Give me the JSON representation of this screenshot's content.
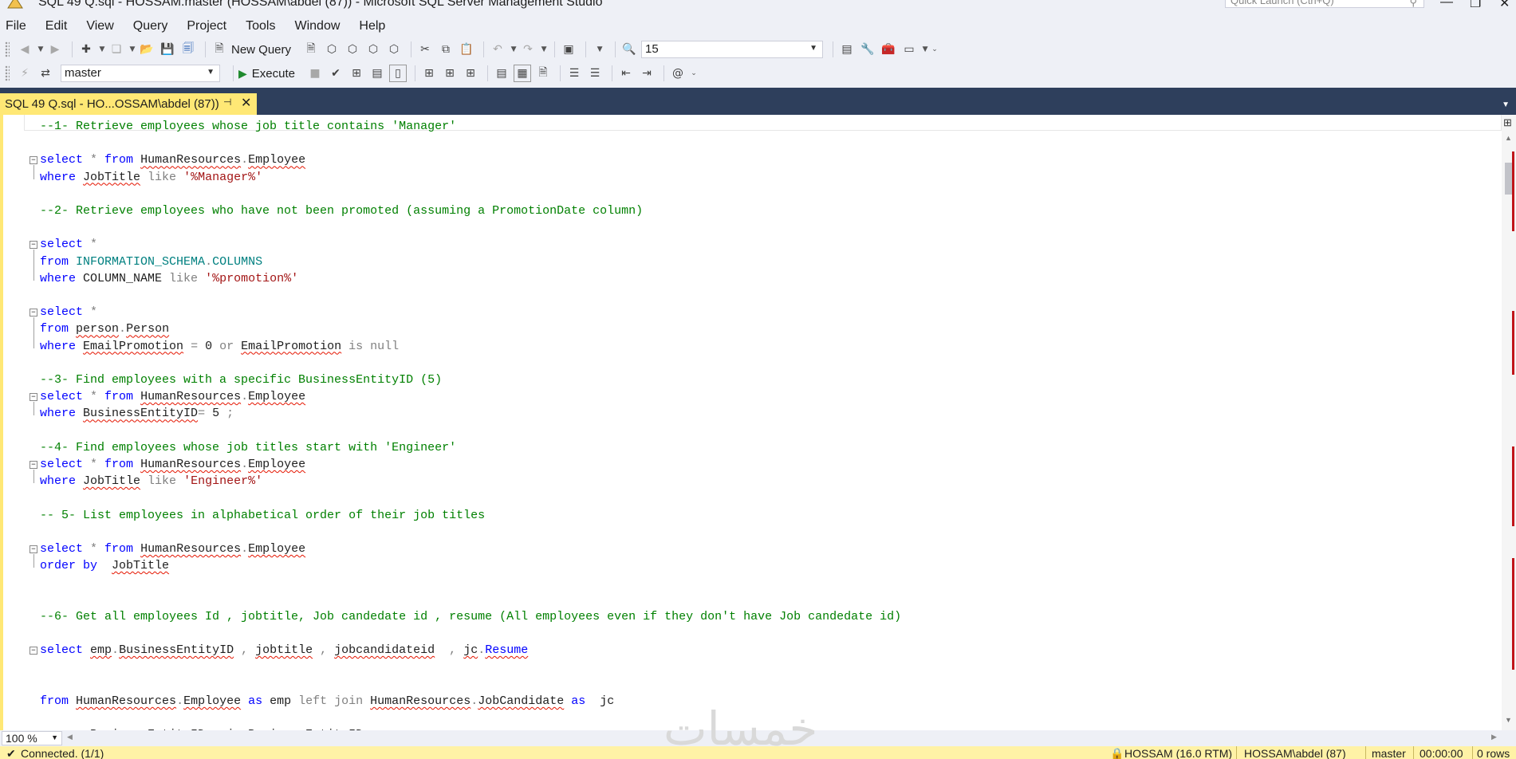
{
  "window": {
    "title": "SQL 49 Q.sql - HOSSAM.master (HOSSAM\\abdel (87)) - Microsoft SQL Server Management Studio",
    "quick_launch_placeholder": "Quick Launch (Ctrl+Q)"
  },
  "menu": [
    "File",
    "Edit",
    "View",
    "Query",
    "Project",
    "Tools",
    "Window",
    "Help"
  ],
  "toolbar": {
    "new_query_label": "New Query",
    "font_size_value": "15",
    "database_value": "master",
    "execute_label": "Execute"
  },
  "tab": {
    "label": "SQL 49 Q.sql - HO...OSSAM\\abdel (87))"
  },
  "code_lines": [
    [
      {
        "t": "--1- Retrieve employees whose job title contains 'Manager'",
        "c": "cm"
      }
    ],
    [],
    [
      {
        "t": "select",
        "c": "kw"
      },
      {
        "t": " * ",
        "c": "gr"
      },
      {
        "t": "from",
        "c": "kw"
      },
      {
        "t": " "
      },
      {
        "t": "HumanResources",
        "c": "sq"
      },
      {
        "t": ".",
        "c": "gr"
      },
      {
        "t": "Employee",
        "c": "sq"
      }
    ],
    [
      {
        "t": "where",
        "c": "kw"
      },
      {
        "t": " "
      },
      {
        "t": "JobTitle",
        "c": "sq"
      },
      {
        "t": " like ",
        "c": "gr"
      },
      {
        "t": "'%Manager%'",
        "c": "st"
      }
    ],
    [],
    [
      {
        "t": "--2- Retrieve employees who have not been promoted (assuming a PromotionDate column)",
        "c": "cm"
      }
    ],
    [],
    [
      {
        "t": "select",
        "c": "kw"
      },
      {
        "t": " *",
        "c": "gr"
      }
    ],
    [
      {
        "t": "from",
        "c": "kw"
      },
      {
        "t": " "
      },
      {
        "t": "INFORMATION_SCHEMA",
        "c": "sy"
      },
      {
        "t": ".",
        "c": "gr"
      },
      {
        "t": "COLUMNS",
        "c": "sy"
      }
    ],
    [
      {
        "t": "where",
        "c": "kw"
      },
      {
        "t": " COLUMN_NAME "
      },
      {
        "t": "like",
        "c": "gr"
      },
      {
        "t": " "
      },
      {
        "t": "'%promotion%'",
        "c": "st"
      }
    ],
    [],
    [
      {
        "t": "select",
        "c": "kw"
      },
      {
        "t": " *",
        "c": "gr"
      }
    ],
    [
      {
        "t": "from",
        "c": "kw"
      },
      {
        "t": " "
      },
      {
        "t": "person",
        "c": "sq"
      },
      {
        "t": ".",
        "c": "gr"
      },
      {
        "t": "Person",
        "c": "sq"
      }
    ],
    [
      {
        "t": "where",
        "c": "kw"
      },
      {
        "t": " "
      },
      {
        "t": "EmailPromotion",
        "c": "sq"
      },
      {
        "t": " = ",
        "c": "gr"
      },
      {
        "t": "0 "
      },
      {
        "t": "or",
        "c": "gr"
      },
      {
        "t": " "
      },
      {
        "t": "EmailPromotion",
        "c": "sq"
      },
      {
        "t": " is null",
        "c": "gr"
      }
    ],
    [],
    [
      {
        "t": "--3- Find employees with a specific BusinessEntityID (5)",
        "c": "cm"
      }
    ],
    [
      {
        "t": "select",
        "c": "kw"
      },
      {
        "t": " * ",
        "c": "gr"
      },
      {
        "t": "from",
        "c": "kw"
      },
      {
        "t": " "
      },
      {
        "t": "HumanResources",
        "c": "sq"
      },
      {
        "t": ".",
        "c": "gr"
      },
      {
        "t": "Employee",
        "c": "sq"
      }
    ],
    [
      {
        "t": "where",
        "c": "kw"
      },
      {
        "t": " "
      },
      {
        "t": "BusinessEntityID",
        "c": "sq"
      },
      {
        "t": "= ",
        "c": "gr"
      },
      {
        "t": "5 "
      },
      {
        "t": ";",
        "c": "gr"
      }
    ],
    [],
    [
      {
        "t": "--4- Find employees whose job titles start with 'Engineer'",
        "c": "cm"
      }
    ],
    [
      {
        "t": "select",
        "c": "kw"
      },
      {
        "t": " * ",
        "c": "gr"
      },
      {
        "t": "from",
        "c": "kw"
      },
      {
        "t": " "
      },
      {
        "t": "HumanResources",
        "c": "sq"
      },
      {
        "t": ".",
        "c": "gr"
      },
      {
        "t": "Employee",
        "c": "sq"
      }
    ],
    [
      {
        "t": "where",
        "c": "kw"
      },
      {
        "t": " "
      },
      {
        "t": "JobTitle",
        "c": "sq"
      },
      {
        "t": " like ",
        "c": "gr"
      },
      {
        "t": "'Engineer%'",
        "c": "st"
      }
    ],
    [],
    [
      {
        "t": "-- 5- List employees in alphabetical order of their job titles",
        "c": "cm"
      }
    ],
    [],
    [
      {
        "t": "select",
        "c": "kw"
      },
      {
        "t": " * ",
        "c": "gr"
      },
      {
        "t": "from",
        "c": "kw"
      },
      {
        "t": " "
      },
      {
        "t": "HumanResources",
        "c": "sq"
      },
      {
        "t": ".",
        "c": "gr"
      },
      {
        "t": "Employee",
        "c": "sq"
      }
    ],
    [
      {
        "t": "order by",
        "c": "kw"
      },
      {
        "t": "  "
      },
      {
        "t": "JobTitle",
        "c": "sq"
      }
    ],
    [],
    [],
    [
      {
        "t": "--6- Get all employees Id , jobtitle, Job candedate id , resume (All employees even if they don't have Job candedate id)",
        "c": "cm"
      }
    ],
    [],
    [
      {
        "t": "select",
        "c": "kw"
      },
      {
        "t": " "
      },
      {
        "t": "emp",
        "c": "sq"
      },
      {
        "t": ".",
        "c": "gr"
      },
      {
        "t": "BusinessEntityID",
        "c": "sq"
      },
      {
        "t": " , ",
        "c": "gr"
      },
      {
        "t": "jobtitle",
        "c": "sq"
      },
      {
        "t": " , ",
        "c": "gr"
      },
      {
        "t": "jobcandidateid",
        "c": "sq"
      },
      {
        "t": "  , ",
        "c": "gr"
      },
      {
        "t": "jc",
        "c": "sq"
      },
      {
        "t": ".",
        "c": "gr"
      },
      {
        "t": "Resume",
        "c": "kw sq"
      }
    ],
    [],
    [],
    [
      {
        "t": "from",
        "c": "kw"
      },
      {
        "t": " "
      },
      {
        "t": "HumanResources",
        "c": "sq"
      },
      {
        "t": ".",
        "c": "gr"
      },
      {
        "t": "Employee",
        "c": "sq"
      },
      {
        "t": " "
      },
      {
        "t": "as",
        "c": "kw"
      },
      {
        "t": " emp "
      },
      {
        "t": "left join",
        "c": "gr"
      },
      {
        "t": " "
      },
      {
        "t": "HumanResources",
        "c": "sq"
      },
      {
        "t": ".",
        "c": "gr"
      },
      {
        "t": "JobCandidate",
        "c": "sq"
      },
      {
        "t": " "
      },
      {
        "t": "as",
        "c": "kw"
      },
      {
        "t": "  jc"
      }
    ],
    [],
    [
      {
        "t": "on emp.BusinessEntityID = jc.BusinessEntityID"
      }
    ]
  ],
  "editor": {
    "zoom_value": "100 %"
  },
  "watermark": "خمسات",
  "status": {
    "connection": "Connected. (1/1)",
    "server": "HOSSAM (16.0 RTM)",
    "user": "HOSSAM\\abdel (87)",
    "database": "master",
    "elapsed": "00:00:00",
    "rows": "0 rows"
  }
}
